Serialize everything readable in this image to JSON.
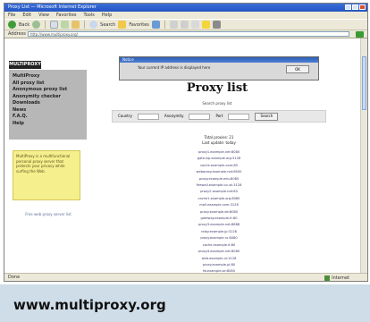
{
  "browser": {
    "title": "Proxy List — Microsoft Internet Explorer",
    "menu": [
      "File",
      "Edit",
      "View",
      "Favorites",
      "Tools",
      "Help"
    ],
    "toolbar": {
      "back": "Back",
      "search": "Search",
      "favorites": "Favorites"
    },
    "address_label": "Address",
    "address": "http://www.multiproxy.org/",
    "status": "Done",
    "zone": "Internet"
  },
  "sidebar": {
    "logo": "MULTIPROXY",
    "nav": [
      "MultiProxy",
      "All proxy list",
      "Anonymous proxy list",
      "Anonymity checker",
      "Downloads",
      "News",
      "F.A.Q.",
      "Help"
    ],
    "note": "MultiProxy is a multifunctional personal proxy server that protects your privacy while surfing the Web.",
    "small_link": "Free web proxy server list"
  },
  "dialog": {
    "title": "Notice",
    "body": "Your current IP address is displayed here",
    "button": "OK"
  },
  "main": {
    "heading": "Proxy list",
    "search_caption": "Search proxy list",
    "search_fields": [
      "Country",
      "Anonymity",
      "Port"
    ],
    "search_button": "Search",
    "stats": [
      "Total proxies: 21",
      "Last update: today"
    ],
    "proxies": [
      "proxy1.example.net:8080",
      "gate.isp.example.org:3128",
      "cache.example.com:80",
      "webproxy.example.net:8000",
      "proxy.example.edu:8080",
      "firewall.example.co.uk:3128",
      "proxy2.example.net:80",
      "cache1.example.org:8080",
      "mail.example.com:3128",
      "proxy.example.de:8080",
      "gateway.example.fr:80",
      "proxy3.example.net:8888",
      "relay.example.jp:3128",
      "proxy.example.ru:8080",
      "cache.example.it:80",
      "proxy4.example.net:8080",
      "web.example.nl:3128",
      "proxy.example.pl:80",
      "fw.example.se:8080",
      "proxy5.example.net:3128",
      "proxy.example.br:8080"
    ]
  },
  "caption": "www.multiproxy.org"
}
